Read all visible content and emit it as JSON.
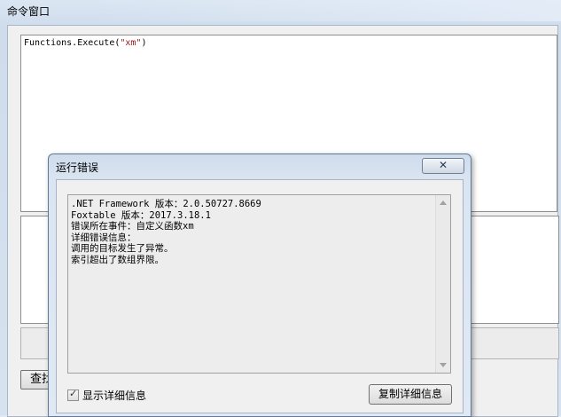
{
  "cmd_window": {
    "title": "命令窗口",
    "code_prefix": "Functions.Execute(",
    "code_string": "\"xm\"",
    "code_suffix": ")",
    "find_button": "查找"
  },
  "error_dialog": {
    "title": "运行错误",
    "close_symbol": "✕",
    "lines": [
      ".NET Framework 版本：2.0.50727.8669",
      "Foxtable 版本：2017.3.18.1",
      "错误所在事件：自定义函数xm",
      "详细错误信息：",
      "调用的目标发生了异常。",
      "索引超出了数组界限。"
    ],
    "show_details_label": "显示详细信息",
    "show_details_checked": true,
    "copy_button": "复制详细信息"
  }
}
